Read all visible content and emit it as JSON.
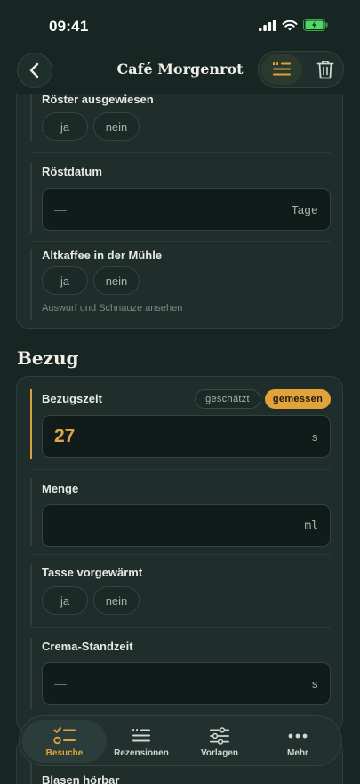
{
  "status": {
    "time": "09:41"
  },
  "nav": {
    "title": "Café Morgenrot"
  },
  "sections": {
    "roast": {
      "roaster_label": "Röster ausgewiesen",
      "roaster_options": [
        "ja",
        "nein"
      ],
      "roast_date_label": "Röstdatum",
      "roast_date_placeholder": "—",
      "roast_date_unit": "Tage",
      "old_coffee_label": "Altkaffee in der Mühle",
      "old_coffee_options": [
        "ja",
        "nein"
      ],
      "old_coffee_hint": "Auswurf und Schnauze ansehen"
    },
    "extraction": {
      "title": "Bezug",
      "time_label": "Bezugszeit",
      "time_modes": [
        "geschätzt",
        "gemessen"
      ],
      "time_mode_selected": "gemessen",
      "time_value": "27",
      "time_unit": "s",
      "amount_label": "Menge",
      "amount_placeholder": "—",
      "amount_unit": "ml",
      "cup_label": "Tasse vorgewärmt",
      "cup_options": [
        "ja",
        "nein"
      ],
      "crema_label": "Crema-Standzeit",
      "crema_placeholder": "—",
      "crema_unit": "s",
      "next_label": "Blasen hörbar"
    }
  },
  "tabbar": {
    "tabs": [
      {
        "label": "Besuche",
        "icon": "checklist-icon",
        "active": true
      },
      {
        "label": "Rezensionen",
        "icon": "review-icon",
        "active": false
      },
      {
        "label": "Vorlagen",
        "icon": "sliders-icon",
        "active": false
      },
      {
        "label": "Mehr",
        "icon": "more-icon",
        "active": false
      }
    ]
  },
  "colors": {
    "accent": "#e2a33b",
    "background": "#172523",
    "card": "#1f2d2b"
  }
}
